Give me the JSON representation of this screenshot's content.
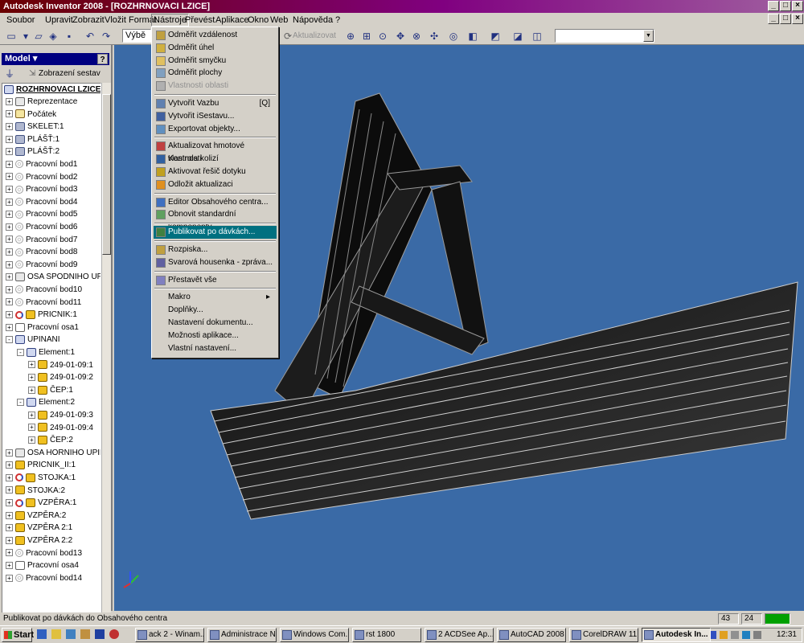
{
  "window": {
    "title": "Autodesk Inventor 2008 - [ROZHRNOVACI LZICE]"
  },
  "menubar": {
    "items": [
      "Soubor",
      "Upravit",
      "Zobrazit",
      "Vložit",
      "Formát",
      "Nástroje",
      "Převést",
      "Aplikace",
      "Okno",
      "Web",
      "Nápověda"
    ],
    "open_menu": "Nástroje"
  },
  "toolbar": {
    "select_label": "Výbě",
    "update_label": "Aktualizovat"
  },
  "panel": {
    "title": "Model",
    "help": "?",
    "view_label": "Zobrazení sestav"
  },
  "tree": {
    "root": "ROZHRNOVACI LZICE.iam",
    "items": [
      {
        "label": "Reprezentace",
        "icon": "rep",
        "level": 0,
        "exp": "+"
      },
      {
        "label": "Počátek",
        "icon": "fld",
        "level": 0,
        "exp": "+"
      },
      {
        "label": "SKELET:1",
        "icon": "sk",
        "level": 0,
        "exp": "+"
      },
      {
        "label": "PLÁŠŤ:1",
        "icon": "sk",
        "level": 0,
        "exp": "+"
      },
      {
        "label": "PLÁŠŤ:2",
        "icon": "sk",
        "level": 0,
        "exp": "+"
      },
      {
        "label": "Pracovní bod1",
        "icon": "wp",
        "level": 0,
        "exp": "+"
      },
      {
        "label": "Pracovní bod2",
        "icon": "wp",
        "level": 0,
        "exp": "+"
      },
      {
        "label": "Pracovní bod3",
        "icon": "wp",
        "level": 0,
        "exp": "+"
      },
      {
        "label": "Pracovní bod4",
        "icon": "wp",
        "level": 0,
        "exp": "+"
      },
      {
        "label": "Pracovní bod5",
        "icon": "wp",
        "level": 0,
        "exp": "+"
      },
      {
        "label": "Pracovní bod6",
        "icon": "wp",
        "level": 0,
        "exp": "+"
      },
      {
        "label": "Pracovní bod7",
        "icon": "wp",
        "level": 0,
        "exp": "+"
      },
      {
        "label": "Pracovní bod8",
        "icon": "wp",
        "level": 0,
        "exp": "+"
      },
      {
        "label": "Pracovní bod9",
        "icon": "wp",
        "level": 0,
        "exp": "+"
      },
      {
        "label": "OSA SPODNIHO UPI",
        "icon": "rep",
        "level": 0,
        "exp": "+"
      },
      {
        "label": "Pracovní bod10",
        "icon": "wp",
        "level": 0,
        "exp": "+"
      },
      {
        "label": "Pracovní bod11",
        "icon": "wp",
        "level": 0,
        "exp": "+"
      },
      {
        "label": "PRICNIK:1",
        "icon": "part",
        "level": 0,
        "exp": "+",
        "ref": true
      },
      {
        "label": "Pracovní osa1",
        "icon": "axis",
        "level": 0,
        "exp": "+"
      },
      {
        "label": "UPINANI",
        "icon": "asm",
        "level": 0,
        "exp": "-"
      },
      {
        "label": "Element:1",
        "icon": "asm",
        "level": 1,
        "exp": "-"
      },
      {
        "label": "249-01-09:1",
        "icon": "part",
        "level": 2,
        "exp": "+"
      },
      {
        "label": "249-01-09:2",
        "icon": "part",
        "level": 2,
        "exp": "+"
      },
      {
        "label": "ČEP:1",
        "icon": "part",
        "level": 2,
        "exp": "+"
      },
      {
        "label": "Element:2",
        "icon": "asm",
        "level": 1,
        "exp": "-"
      },
      {
        "label": "249-01-09:3",
        "icon": "part",
        "level": 2,
        "exp": "+"
      },
      {
        "label": "249-01-09:4",
        "icon": "part",
        "level": 2,
        "exp": "+"
      },
      {
        "label": "ČEP:2",
        "icon": "part",
        "level": 2,
        "exp": "+"
      },
      {
        "label": "OSA HORNIHO UPIN",
        "icon": "rep",
        "level": 0,
        "exp": "+"
      },
      {
        "label": "PRICNIK_II:1",
        "icon": "part",
        "level": 0,
        "exp": "+"
      },
      {
        "label": "STOJKA:1",
        "icon": "part",
        "level": 0,
        "exp": "+",
        "ref": true
      },
      {
        "label": "STOJKA:2",
        "icon": "part",
        "level": 0,
        "exp": "+"
      },
      {
        "label": "VZPĚRA:1",
        "icon": "part",
        "level": 0,
        "exp": "+",
        "ref": true
      },
      {
        "label": "VZPĚRA:2",
        "icon": "part",
        "level": 0,
        "exp": "+"
      },
      {
        "label": "VZPĚRA 2:1",
        "icon": "part",
        "level": 0,
        "exp": "+"
      },
      {
        "label": "VZPĚRA 2:2",
        "icon": "part",
        "level": 0,
        "exp": "+"
      },
      {
        "label": "Pracovní bod13",
        "icon": "wp",
        "level": 0,
        "exp": "+"
      },
      {
        "label": "Pracovní osa4",
        "icon": "axis",
        "level": 0,
        "exp": "+"
      },
      {
        "label": "Pracovní bod14",
        "icon": "wp",
        "level": 0,
        "exp": "+"
      }
    ]
  },
  "tools_menu": {
    "items": [
      {
        "label": "Odměřit vzdálenost",
        "state": "normal"
      },
      {
        "label": "Odměřit úhel",
        "state": "normal"
      },
      {
        "label": "Odměřit smyčku",
        "state": "normal"
      },
      {
        "label": "Odměřit plochy",
        "state": "normal"
      },
      {
        "label": "Vlastnosti oblasti",
        "state": "disabled"
      },
      {
        "sep": true
      },
      {
        "label": "Vytvořit Vazbu",
        "shortcut": "[Q]",
        "state": "normal"
      },
      {
        "label": "Vytvořit iSestavu...",
        "state": "normal"
      },
      {
        "label": "Exportovat objekty...",
        "state": "normal"
      },
      {
        "sep": true
      },
      {
        "label": "Aktualizovat hmotové vlastnosti",
        "state": "normal"
      },
      {
        "label": "Kontrola kolizí",
        "state": "normal"
      },
      {
        "label": "Aktivovat řešič dotyku",
        "state": "normal"
      },
      {
        "label": "Odložit aktualizaci",
        "state": "normal"
      },
      {
        "sep": true
      },
      {
        "label": "Editor Obsahového centra...",
        "state": "normal"
      },
      {
        "label": "Obnovit standardní komponenty...",
        "state": "normal"
      },
      {
        "sep": true
      },
      {
        "label": "Publikovat po dávkách...",
        "state": "highlighted"
      },
      {
        "sep": true
      },
      {
        "label": "Rozpiska...",
        "state": "normal"
      },
      {
        "label": "Svarová housenka - zpráva...",
        "state": "normal"
      },
      {
        "sep": true
      },
      {
        "label": "Přestavět vše",
        "state": "normal"
      },
      {
        "sep": true
      },
      {
        "label": "Makro",
        "submenu": true,
        "state": "normal"
      },
      {
        "label": "Doplňky...",
        "state": "normal"
      },
      {
        "label": "Nastavení dokumentu...",
        "state": "normal"
      },
      {
        "label": "Možnosti aplikace...",
        "state": "normal"
      },
      {
        "label": "Vlastní nastavení...",
        "state": "normal"
      }
    ]
  },
  "statusbar": {
    "text": "Publikovat po dávkách do Obsahového centra",
    "num1": "43",
    "num2": "24"
  },
  "taskbar": {
    "start": "Start",
    "tasks": [
      "ack 2 - Winam...",
      "Administrace N...",
      "Windows Com...",
      "rst 1800",
      "2 ACDSee Ap...",
      "AutoCAD 2008 ...",
      "CorelDRAW 11",
      "Autodesk In..."
    ],
    "clock": "12:31"
  }
}
